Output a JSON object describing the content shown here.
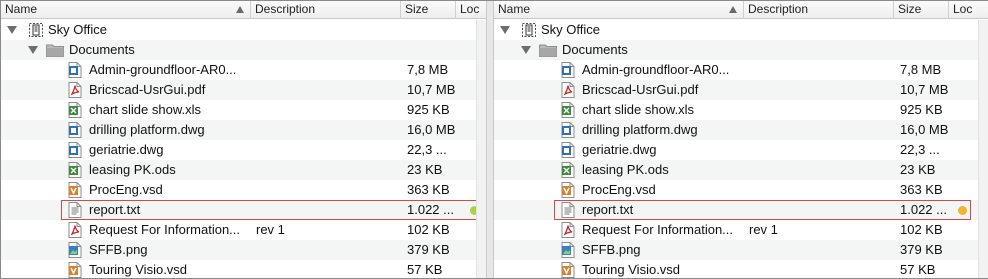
{
  "columns": {
    "name": "Name",
    "description": "Description",
    "size": "Size",
    "location": "Loc"
  },
  "server": {
    "label": "Sky Office",
    "icon": "server-icon"
  },
  "folder": {
    "label": "Documents",
    "icon": "folder-icon"
  },
  "files": [
    {
      "name": "Admin-groundfloor-AR0...",
      "description": "",
      "size": "7,8 MB",
      "icon": "dwg-file-icon"
    },
    {
      "name": "Bricscad-UsrGui.pdf",
      "description": "",
      "size": "10,7 MB",
      "icon": "pdf-file-icon"
    },
    {
      "name": "chart slide show.xls",
      "description": "",
      "size": "925 KB",
      "icon": "spreadsheet-file-icon"
    },
    {
      "name": "drilling platform.dwg",
      "description": "",
      "size": "16,0 MB",
      "icon": "dwg-file-icon"
    },
    {
      "name": "geriatrie.dwg",
      "description": "",
      "size": "22,3 ...",
      "icon": "dwg-file-icon"
    },
    {
      "name": "leasing PK.ods",
      "description": "",
      "size": "23 KB",
      "icon": "spreadsheet-file-icon"
    },
    {
      "name": "ProcEng.vsd",
      "description": "",
      "size": "363 KB",
      "icon": "visio-file-icon"
    },
    {
      "name": "report.txt",
      "description": "",
      "size": "1.022 ...",
      "icon": "text-file-icon"
    },
    {
      "name": "Request For Information...",
      "description": "rev 1",
      "size": "102 KB",
      "icon": "pdf-file-icon"
    },
    {
      "name": "SFFB.png",
      "description": "",
      "size": "379 KB",
      "icon": "image-file-icon"
    },
    {
      "name": "Touring Visio.vsd",
      "description": "",
      "size": "57 KB",
      "icon": "visio-file-icon"
    }
  ],
  "panes": [
    {
      "id": "left",
      "status_dot_color": "#a8d43c"
    },
    {
      "id": "right",
      "status_dot_color": "#f3b531"
    }
  ],
  "colors": {
    "highlight_border": "#d44a4a",
    "pdf": "#c62828",
    "dwg": "#2f6fc2",
    "spreadsheet": "#3d8b3d",
    "visio": "#d9822b"
  }
}
